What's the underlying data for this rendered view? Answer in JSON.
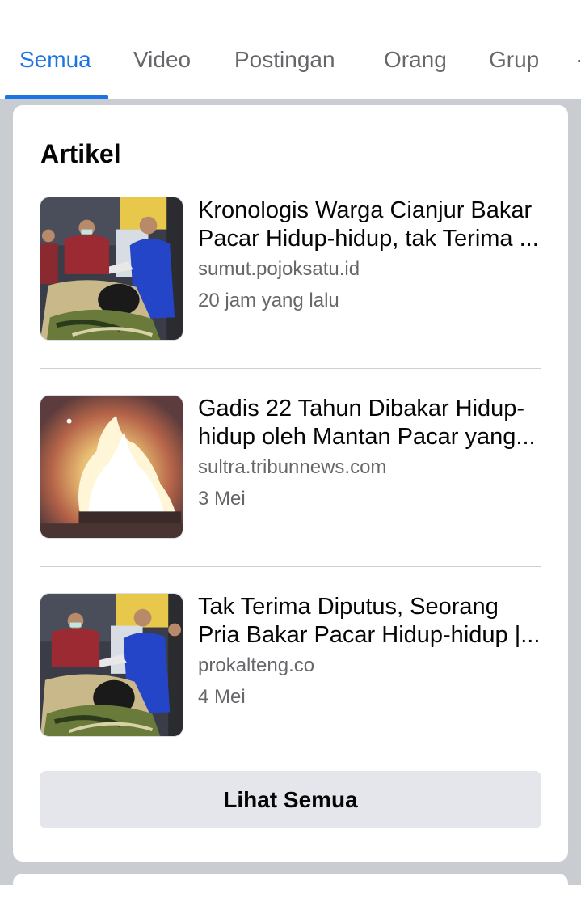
{
  "tabs": [
    {
      "label": "Semua",
      "active": true
    },
    {
      "label": "Video",
      "active": false
    },
    {
      "label": "Postingan",
      "active": false
    },
    {
      "label": "Orang",
      "active": false
    },
    {
      "label": "Grup",
      "active": false
    }
  ],
  "accent_color": "#1b74e4",
  "section": {
    "title": "Artikel",
    "see_all_label": "Lihat Semua"
  },
  "articles": [
    {
      "title_line1": "Kronologis Warga Cianjur Bakar",
      "title_line2": "Pacar Hidup-hidup, tak Terima ...",
      "source": "sumut.pojoksatu.id",
      "time": "20 jam yang lalu",
      "thumbnail": "hospital-scene-photo"
    },
    {
      "title_line1": "Gadis 22 Tahun Dibakar Hidup-",
      "title_line2": "hidup oleh Mantan Pacar yang...",
      "source": "sultra.tribunnews.com",
      "time": "3 Mei",
      "thumbnail": "fire-photo"
    },
    {
      "title_line1": "Tak Terima Diputus, Seorang",
      "title_line2": "Pria Bakar Pacar Hidup-hidup |...",
      "source": "prokalteng.co",
      "time": "4 Mei",
      "thumbnail": "hospital-scene-photo"
    }
  ]
}
